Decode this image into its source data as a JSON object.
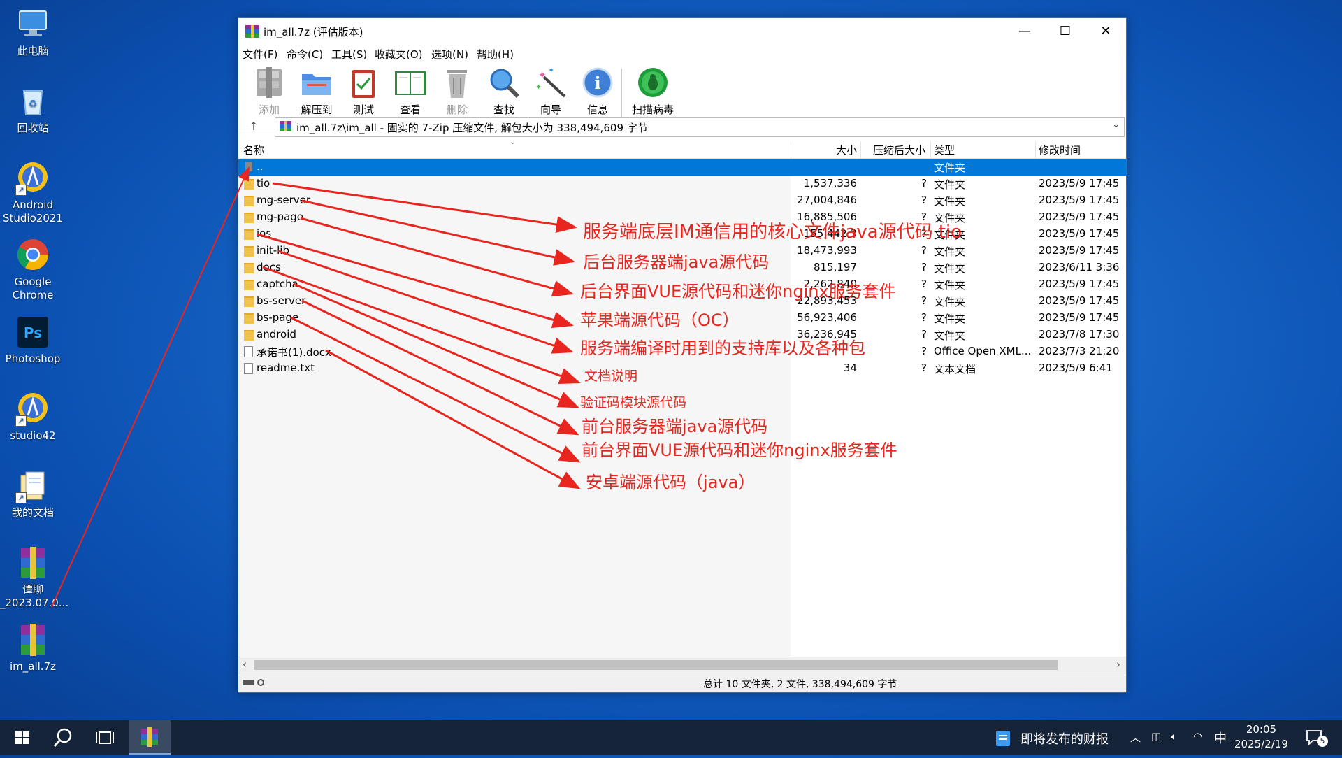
{
  "desktop": {
    "icons": [
      {
        "label": "此电脑"
      },
      {
        "label": "回收站"
      },
      {
        "label": "Android Studio2021"
      },
      {
        "label": "Google Chrome"
      },
      {
        "label": "Photoshop"
      },
      {
        "label": "studio42"
      },
      {
        "label": "我的文档"
      },
      {
        "label": "谭聊 _2023.07.0..."
      },
      {
        "label": "im_all.7z"
      }
    ]
  },
  "window": {
    "title": "im_all.7z (评估版本)",
    "menu": [
      "文件(F)",
      "命令(C)",
      "工具(S)",
      "收藏夹(O)",
      "选项(N)",
      "帮助(H)"
    ],
    "toolbar": [
      {
        "label": "添加",
        "enabled": false
      },
      {
        "label": "解压到",
        "enabled": true
      },
      {
        "label": "测试",
        "enabled": true
      },
      {
        "label": "查看",
        "enabled": true
      },
      {
        "label": "删除",
        "enabled": false
      },
      {
        "label": "查找",
        "enabled": true
      },
      {
        "label": "向导",
        "enabled": true
      },
      {
        "label": "信息",
        "enabled": true
      },
      {
        "label": "扫描病毒",
        "enabled": true
      }
    ],
    "address": "im_all.7z\\im_all - 固实的 7-Zip 压缩文件, 解包大小为 338,494,609 字节",
    "columns": {
      "name": "名称",
      "size": "大小",
      "packed": "压缩后大小",
      "type": "类型",
      "modified": "修改时间"
    },
    "rows": [
      {
        "name": "..",
        "size": "",
        "packed": "",
        "type": "文件夹",
        "modified": "",
        "kind": "up"
      },
      {
        "name": "tio",
        "size": "1,537,336",
        "packed": "?",
        "type": "文件夹",
        "modified": "2023/5/9 17:45",
        "kind": "folder"
      },
      {
        "name": "mg-server",
        "size": "27,004,846",
        "packed": "?",
        "type": "文件夹",
        "modified": "2023/5/9 17:45",
        "kind": "folder"
      },
      {
        "name": "mg-page",
        "size": "16,885,506",
        "packed": "?",
        "type": "文件夹",
        "modified": "2023/5/9 17:45",
        "kind": "folder"
      },
      {
        "name": "ios",
        "size": "155,442,3",
        "packed": "?",
        "type": "文件夹",
        "modified": "2023/5/9 17:45",
        "kind": "folder"
      },
      {
        "name": "init-lib",
        "size": "18,473,993",
        "packed": "?",
        "type": "文件夹",
        "modified": "2023/5/9 17:45",
        "kind": "folder"
      },
      {
        "name": "docs",
        "size": "815,197",
        "packed": "?",
        "type": "文件夹",
        "modified": "2023/6/11 3:36",
        "kind": "folder"
      },
      {
        "name": "captcha",
        "size": "2,262,840",
        "packed": "?",
        "type": "文件夹",
        "modified": "2023/5/9 17:45",
        "kind": "folder"
      },
      {
        "name": "bs-server",
        "size": "22,893,453",
        "packed": "?",
        "type": "文件夹",
        "modified": "2023/5/9 17:45",
        "kind": "folder"
      },
      {
        "name": "bs-page",
        "size": "56,923,406",
        "packed": "?",
        "type": "文件夹",
        "modified": "2023/5/9 17:45",
        "kind": "folder"
      },
      {
        "name": "android",
        "size": "36,236,945",
        "packed": "?",
        "type": "文件夹",
        "modified": "2023/7/8 17:30",
        "kind": "folder"
      },
      {
        "name": "承诺书(1).docx",
        "size": "",
        "packed": "?",
        "type": "Office Open XML...",
        "modified": "2023/7/3 21:20",
        "kind": "doc"
      },
      {
        "name": "readme.txt",
        "size": "34",
        "packed": "?",
        "type": "文本文档",
        "modified": "2023/5/9 6:41",
        "kind": "doc"
      }
    ],
    "status": "总计 10 文件夹, 2 文件, 338,494,609 字节"
  },
  "annotations": [
    "服务端底层IM通信用的核心文件java源代码 tio",
    "后台服务器端java源代码",
    "后台界面VUE源代码和迷你nginx服务套件",
    "苹果端源代码（OC）",
    "服务端编译时用到的支持库以及各种包",
    "文档说明",
    "验证码模块源代码",
    "前台服务器端java源代码",
    "前台界面VUE源代码和迷你nginx服务套件",
    "安卓端源代码（java）"
  ],
  "annotation_color": "#e8261f",
  "taskbar": {
    "news": "即将发布的财报",
    "ime": "中",
    "time": "20:05",
    "date": "2025/2/19",
    "notifications": "5"
  }
}
